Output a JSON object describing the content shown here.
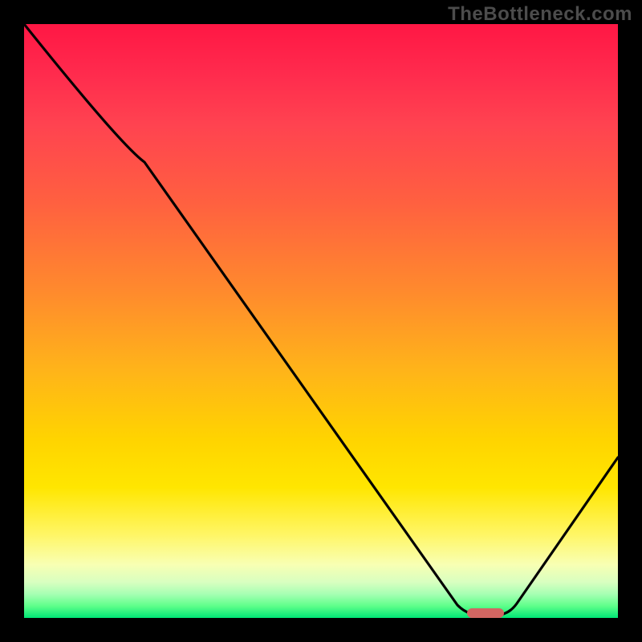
{
  "watermark": "TheBottleneck.com",
  "chart_data": {
    "type": "line",
    "title": "",
    "xlabel": "",
    "ylabel": "",
    "xlim": [
      0,
      100
    ],
    "ylim": [
      0,
      100
    ],
    "x": [
      0,
      20,
      74,
      80,
      100
    ],
    "values": [
      100,
      77,
      0,
      0,
      27
    ],
    "optimal_range_x": [
      74,
      80
    ],
    "optimal_y": 0,
    "gradient_stops": [
      {
        "pos": 0,
        "color": "#ff1744"
      },
      {
        "pos": 30,
        "color": "#ff6040"
      },
      {
        "pos": 58,
        "color": "#ffb31a"
      },
      {
        "pos": 78,
        "color": "#ffe600"
      },
      {
        "pos": 100,
        "color": "#00e676"
      }
    ],
    "marker": {
      "x_start": 74,
      "x_end": 80,
      "color": "#d26662"
    }
  }
}
